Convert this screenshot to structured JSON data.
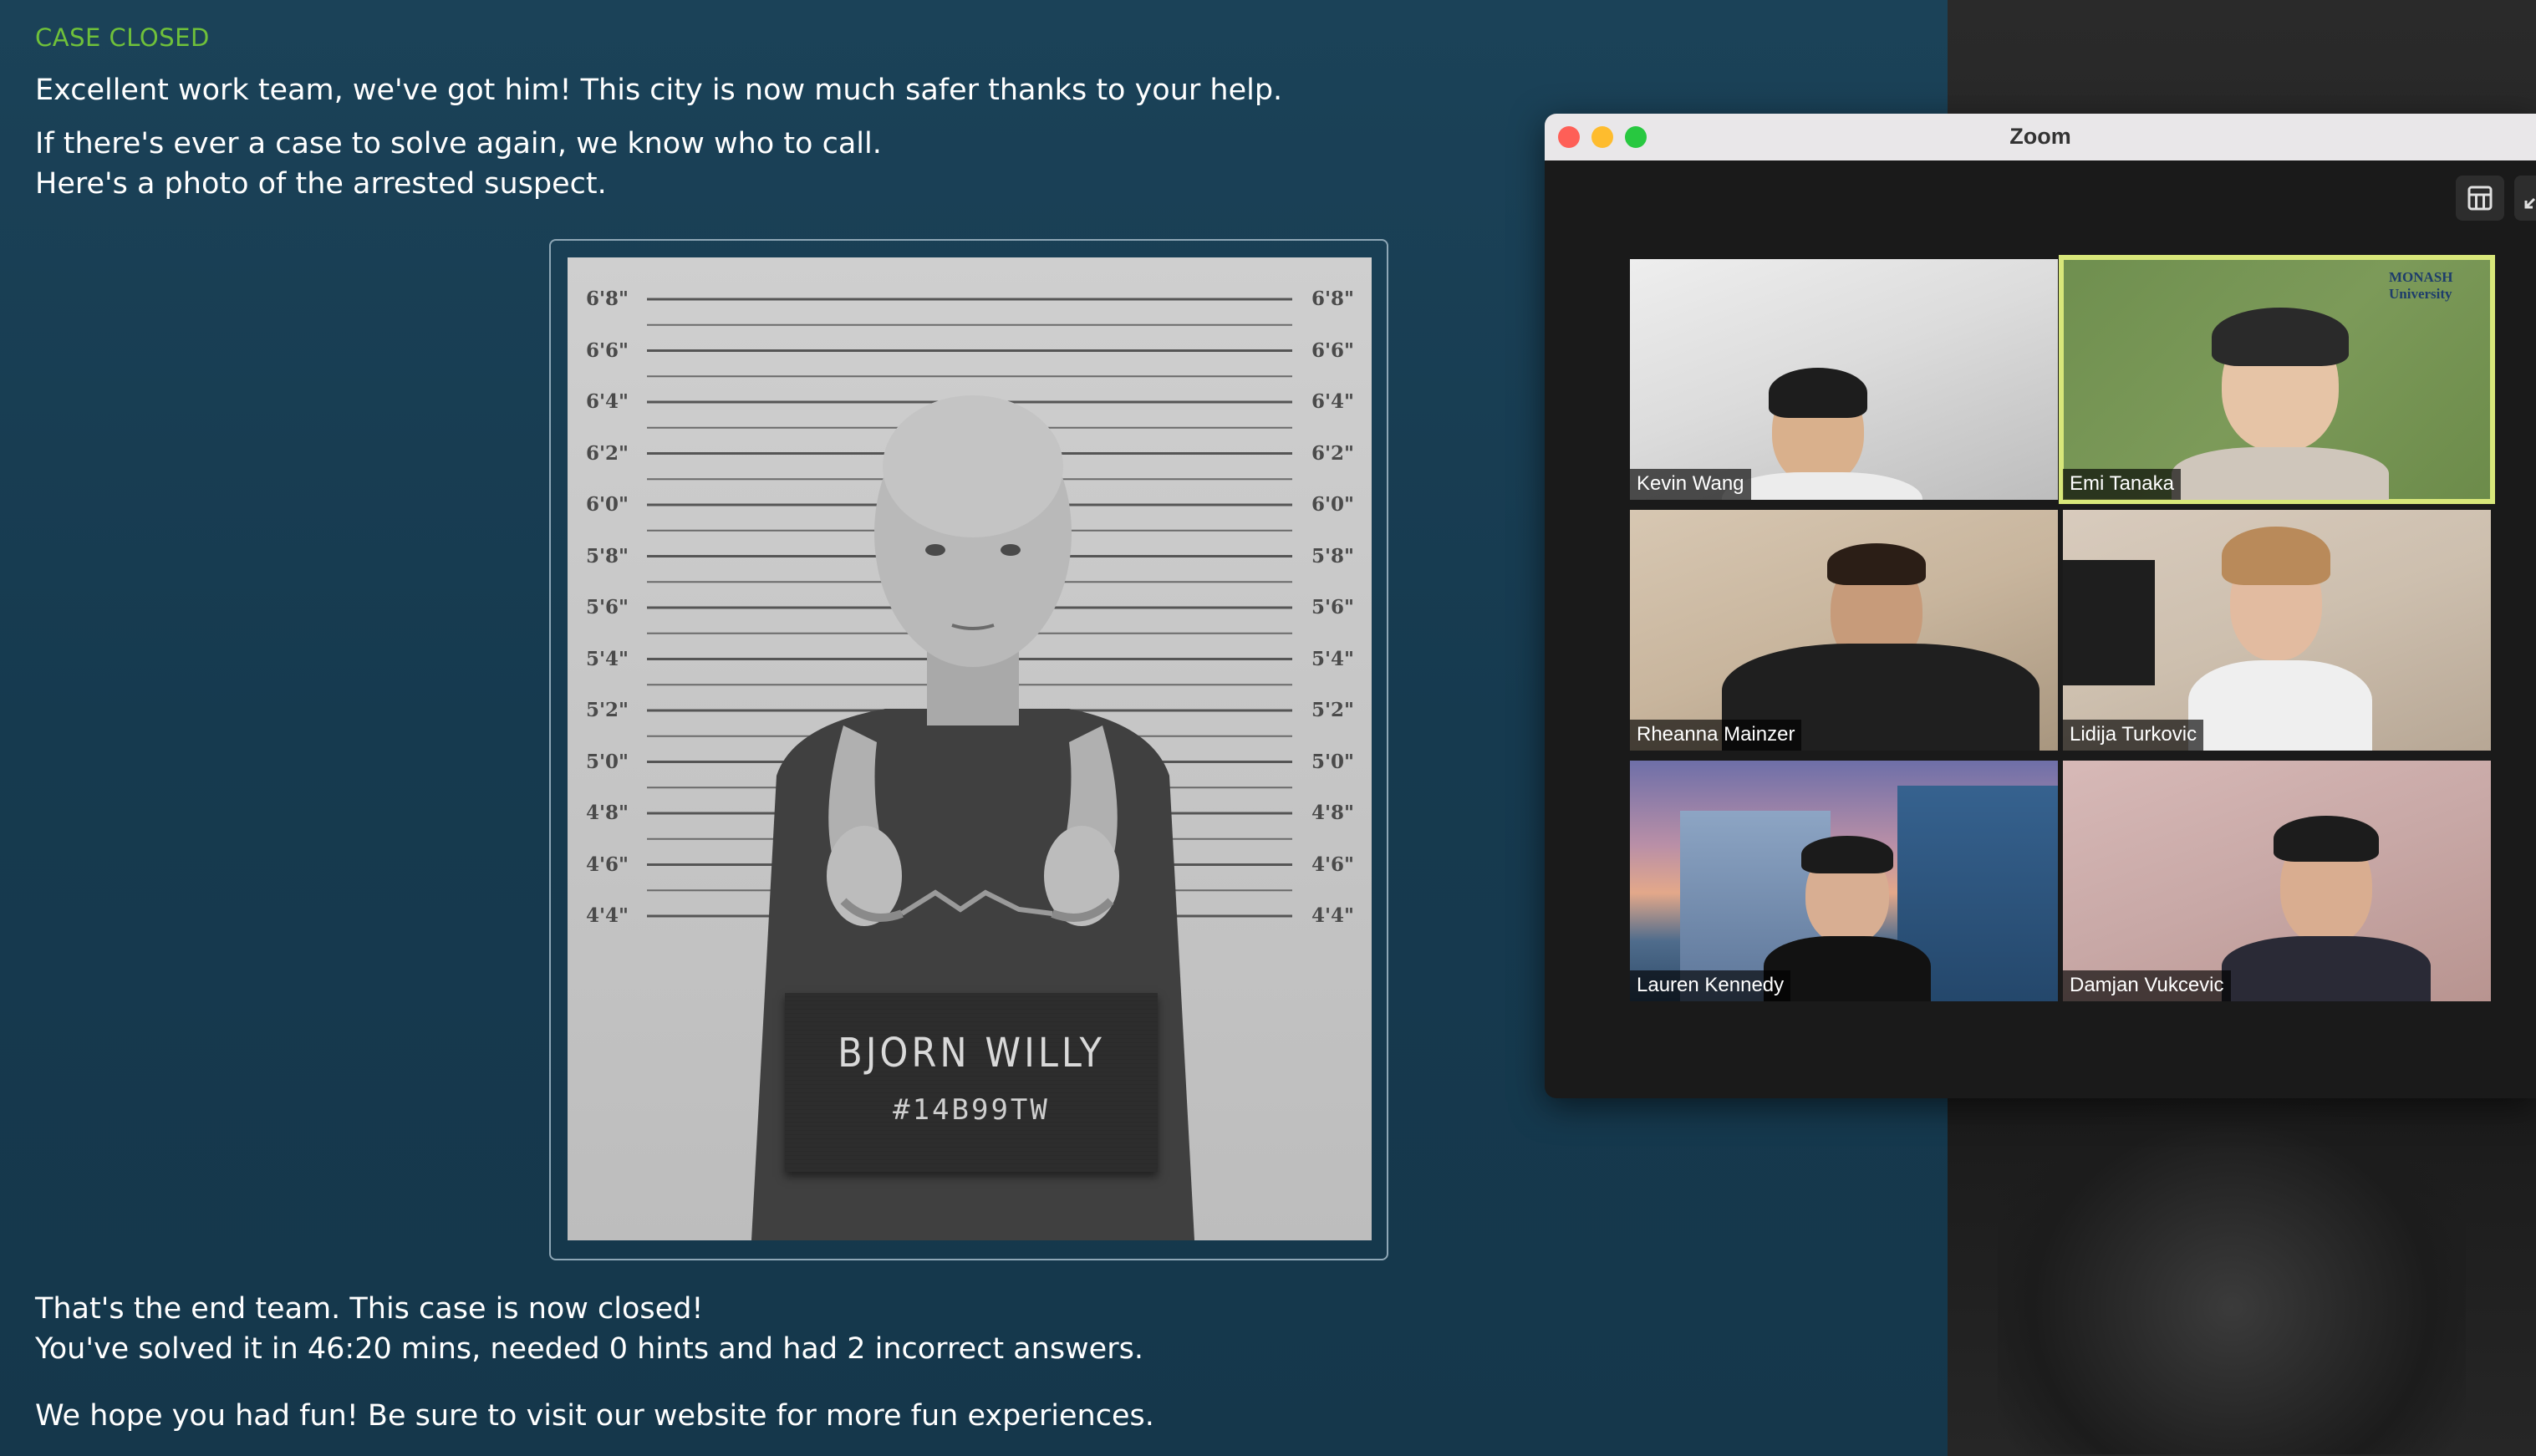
{
  "page": {
    "case_label": "CASE CLOSED",
    "intro_line": "Excellent work team, we've got him! This city is now much safer thanks to your help.",
    "call_line": "If there's ever a case to solve again, we know who to call.",
    "photo_line": "Here's a photo of the arrested suspect.",
    "end_line": "That's the end team. This case is now closed!",
    "stats_line": "You've solved it in 46:20 mins, needed 0 hints and had 2 incorrect answers.",
    "fun_line": "We hope you had fun! Be sure to visit our website for more fun experiences."
  },
  "mugshot": {
    "height_marks": [
      "6'8\"",
      "6'6\"",
      "6'4\"",
      "6'2\"",
      "6'0\"",
      "5'8\"",
      "5'6\"",
      "5'4\"",
      "5'2\"",
      "5'0\"",
      "4'8\"",
      "4'6\"",
      "4'4\""
    ],
    "placard_name": "BJORN WILLY",
    "placard_id": "#14B99TW"
  },
  "zoom": {
    "window_title": "Zoom",
    "participants": [
      {
        "name": "Kevin Wang",
        "active": false
      },
      {
        "name": "Emi Tanaka",
        "active": true
      },
      {
        "name": "Rheanna Mainzer",
        "active": false
      },
      {
        "name": "Lidija Turkovic",
        "active": false
      },
      {
        "name": "Lauren Kennedy",
        "active": false
      },
      {
        "name": "Damjan Vukcevic",
        "active": false
      }
    ],
    "emi_background_logo": "MONASH University"
  },
  "colors": {
    "accent_green": "#6fc13a",
    "active_speaker": "#d8e77a",
    "background": "#183d52"
  }
}
